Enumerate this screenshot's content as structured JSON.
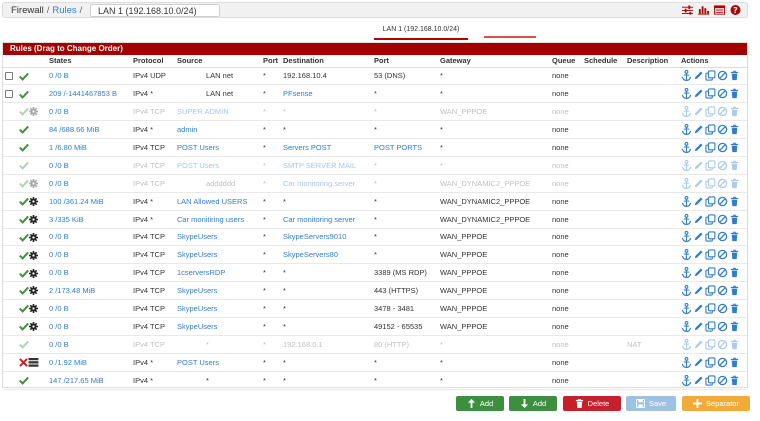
{
  "breadcrumb": {
    "firewall": "Firewall",
    "rules": "Rules",
    "lan": "LAN 1 (192.168.10.0/24)"
  },
  "tabs": {
    "active": "LAN 1 (192.168.10.0/24)"
  },
  "panel": {
    "title": "Rules (Drag to Change Order)"
  },
  "columns": [
    "",
    "States",
    "Protocol",
    "Source",
    "Port",
    "Destination",
    "Port",
    "Gateway",
    "Queue",
    "Schedule",
    "Description",
    "Actions"
  ],
  "rules": [
    {
      "checkbox": true,
      "status": "check",
      "disabled": false,
      "states": "0 /0 B",
      "protocol": "IPv4 UDP",
      "source": "LAN net",
      "src_link": false,
      "src_port": "*",
      "destination": "192.168.10.4",
      "dst_link": false,
      "dst_port": "53 (DNS)",
      "dst_port_link": false,
      "gateway": "*",
      "queue": "none",
      "schedule": "",
      "description": ""
    },
    {
      "checkbox": true,
      "status": "check",
      "disabled": false,
      "states": "209 /-1441467853 B",
      "protocol": "IPv4 *",
      "source": "LAN net",
      "src_link": false,
      "src_port": "*",
      "destination": "PFsense",
      "dst_link": true,
      "dst_port": "*",
      "dst_port_link": false,
      "gateway": "*",
      "queue": "none",
      "schedule": "",
      "description": ""
    },
    {
      "checkbox": false,
      "status": "check-gear",
      "disabled": true,
      "states": "0 /0 B",
      "protocol": "IPv4 TCP",
      "source": "SUPER ADMIN",
      "src_link": true,
      "src_port": "*",
      "destination": "*",
      "dst_link": false,
      "dst_port": "*",
      "dst_port_link": false,
      "gateway": "WAN_PPPOE",
      "queue": "none",
      "schedule": "",
      "description": ""
    },
    {
      "checkbox": false,
      "status": "check",
      "disabled": false,
      "states": "84 /688.66 MiB",
      "protocol": "IPv4 *",
      "source": "admin",
      "src_link": true,
      "src_port": "*",
      "destination": "*",
      "dst_link": false,
      "dst_port": "*",
      "dst_port_link": false,
      "gateway": "*",
      "queue": "none",
      "schedule": "",
      "description": ""
    },
    {
      "checkbox": false,
      "status": "check",
      "disabled": false,
      "states": "1 /6.80 MiB",
      "protocol": "IPv4 TCP",
      "source": "POST Users",
      "src_link": true,
      "src_port": "*",
      "destination": "Servers POST",
      "dst_link": true,
      "dst_port": "POST PORTS",
      "dst_port_link": true,
      "gateway": "*",
      "queue": "none",
      "schedule": "",
      "description": ""
    },
    {
      "checkbox": false,
      "status": "check",
      "disabled": true,
      "states": "0 /0 B",
      "protocol": "IPv4 TCP",
      "source": "POST Users",
      "src_link": true,
      "src_port": "*",
      "destination": "SMTP SERVER MAIL",
      "dst_link": true,
      "dst_port": "*",
      "dst_port_link": false,
      "gateway": "*",
      "queue": "none",
      "schedule": "",
      "description": ""
    },
    {
      "checkbox": false,
      "status": "check-gear",
      "disabled": true,
      "states": "0 /0 B",
      "protocol": "IPv4 TCP",
      "source": "adddddd",
      "src_link": false,
      "src_port": "*",
      "destination": "Car monitoring server",
      "dst_link": true,
      "dst_port": "*",
      "dst_port_link": false,
      "gateway": "WAN_DYNAMIC2_PPPOE",
      "queue": "none",
      "schedule": "",
      "description": ""
    },
    {
      "checkbox": false,
      "status": "check-gear",
      "disabled": false,
      "states": "100 /361.24 MiB",
      "protocol": "IPv4 *",
      "source": "LAN Allowed USERS",
      "src_link": true,
      "src_port": "*",
      "destination": "*",
      "dst_link": false,
      "dst_port": "*",
      "dst_port_link": false,
      "gateway": "WAN_DYNAMIC2_PPPOE",
      "queue": "none",
      "schedule": "",
      "description": ""
    },
    {
      "checkbox": false,
      "status": "check-gear",
      "disabled": false,
      "states": "3 /335 KiB",
      "protocol": "IPv4 *",
      "source": "Car monitiring users",
      "src_link": true,
      "src_port": "*",
      "destination": "Car monitoring server",
      "dst_link": true,
      "dst_port": "*",
      "dst_port_link": false,
      "gateway": "WAN_DYNAMIC2_PPPOE",
      "queue": "none",
      "schedule": "",
      "description": ""
    },
    {
      "checkbox": false,
      "status": "check-gear",
      "disabled": false,
      "states": "0 /0 B",
      "protocol": "IPv4 TCP",
      "source": "SkypeUsers",
      "src_link": true,
      "src_port": "*",
      "destination": "SkypeServers9010",
      "dst_link": true,
      "dst_port": "*",
      "dst_port_link": false,
      "gateway": "WAN_PPPOE",
      "queue": "none",
      "schedule": "",
      "description": ""
    },
    {
      "checkbox": false,
      "status": "check-gear",
      "disabled": false,
      "states": "0 /0 B",
      "protocol": "IPv4 TCP",
      "source": "SkypeUsers",
      "src_link": true,
      "src_port": "*",
      "destination": "SkypeServers80",
      "dst_link": true,
      "dst_port": "*",
      "dst_port_link": false,
      "gateway": "WAN_PPPOE",
      "queue": "none",
      "schedule": "",
      "description": ""
    },
    {
      "checkbox": false,
      "status": "check-gear",
      "disabled": false,
      "states": "0 /0 B",
      "protocol": "IPv4 TCP",
      "source": "1cserversRDP",
      "src_link": true,
      "src_port": "*",
      "destination": "*",
      "dst_link": false,
      "dst_port": "3389 (MS RDP)",
      "dst_port_link": false,
      "gateway": "WAN_PPPOE",
      "queue": "none",
      "schedule": "",
      "description": ""
    },
    {
      "checkbox": false,
      "status": "check-gear",
      "disabled": false,
      "states": "2 /173.48 MiB",
      "protocol": "IPv4 TCP",
      "source": "SkypeUsers",
      "src_link": true,
      "src_port": "*",
      "destination": "*",
      "dst_link": false,
      "dst_port": "443 (HTTPS)",
      "dst_port_link": false,
      "gateway": "WAN_PPPOE",
      "queue": "none",
      "schedule": "",
      "description": ""
    },
    {
      "checkbox": false,
      "status": "check-gear",
      "disabled": false,
      "states": "0 /0 B",
      "protocol": "IPv4 TCP",
      "source": "SkypeUsers",
      "src_link": true,
      "src_port": "*",
      "destination": "*",
      "dst_link": false,
      "dst_port": "3478 - 3481",
      "dst_port_link": false,
      "gateway": "WAN_PPPOE",
      "queue": "none",
      "schedule": "",
      "description": ""
    },
    {
      "checkbox": false,
      "status": "check-gear",
      "disabled": false,
      "states": "0 /0 B",
      "protocol": "IPv4 TCP",
      "source": "SkypeUsers",
      "src_link": true,
      "src_port": "*",
      "destination": "*",
      "dst_link": false,
      "dst_port": "49152 - 65535",
      "dst_port_link": false,
      "gateway": "WAN_PPPOE",
      "queue": "none",
      "schedule": "",
      "description": ""
    },
    {
      "checkbox": false,
      "status": "check",
      "disabled": true,
      "states": "0 /0 B",
      "protocol": "IPv4 TCP",
      "source": "*",
      "src_link": false,
      "src_port": "*",
      "destination": "192.168.0.1",
      "dst_link": false,
      "dst_port": "80 (HTTP)",
      "dst_port_link": false,
      "gateway": "*",
      "queue": "none",
      "schedule": "",
      "description": "NAT"
    },
    {
      "checkbox": false,
      "status": "block-list",
      "disabled": false,
      "states": "0 /1.92 MiB",
      "protocol": "IPv4 *",
      "source": "POST Users",
      "src_link": true,
      "src_port": "*",
      "destination": "*",
      "dst_link": false,
      "dst_port": "*",
      "dst_port_link": false,
      "gateway": "*",
      "queue": "none",
      "schedule": "",
      "description": ""
    },
    {
      "checkbox": false,
      "status": "check",
      "disabled": false,
      "states": "147 /217.65 MiB",
      "protocol": "IPv4 *",
      "source": "*",
      "src_link": false,
      "src_port": "*",
      "destination": "*",
      "dst_link": false,
      "dst_port": "*",
      "dst_port_link": false,
      "gateway": "*",
      "queue": "none",
      "schedule": "",
      "description": ""
    }
  ],
  "buttons": {
    "add_top": "Add",
    "add_bottom": "Add",
    "delete": "Delete",
    "save": "Save",
    "separator": "Separator"
  },
  "colors": {
    "header": "#a30000",
    "link": "#317ec6",
    "pass": "#3f8f3f",
    "block": "#c8202a",
    "add": "#3d8f3d",
    "delete": "#c8202a",
    "save": "#9cc1e3",
    "separator": "#f0ac39"
  }
}
